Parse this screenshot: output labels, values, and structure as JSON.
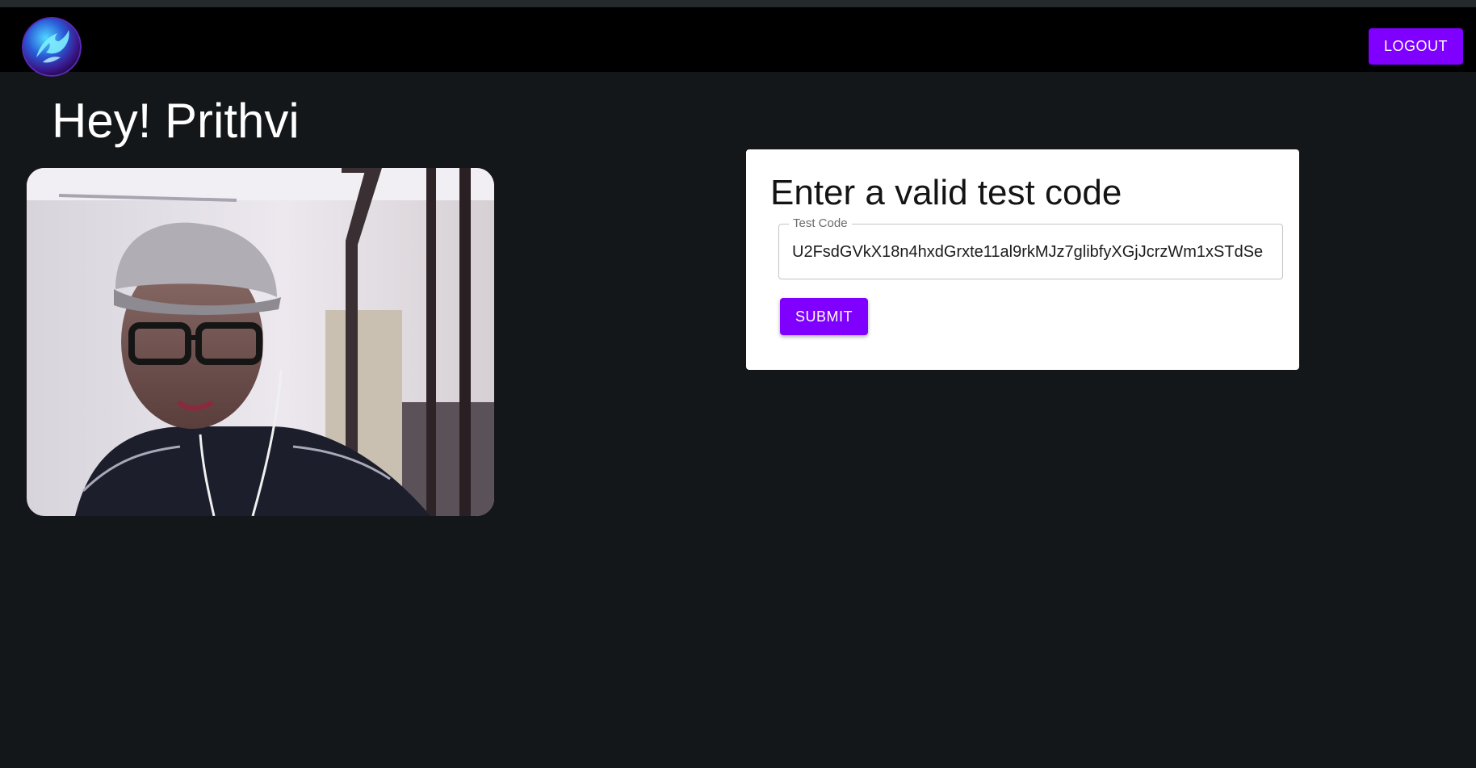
{
  "navbar": {
    "logo_icon": "dragon-logo-icon",
    "logout_label": "LOGOUT"
  },
  "greeting": "Hey! Prithvi",
  "webcam": {
    "icon": "webcam-feed"
  },
  "test_card": {
    "title": "Enter a valid test code",
    "field_label": "Test Code",
    "field_value": "U2FsdGVkX18n4hxdGrxte11al9rkMJz7glibfyXGjJcrzWm1xSTdSe",
    "submit_label": "SUBMIT"
  },
  "colors": {
    "accent": "#7f00ff",
    "background": "#141719",
    "navbar": "#000000"
  }
}
